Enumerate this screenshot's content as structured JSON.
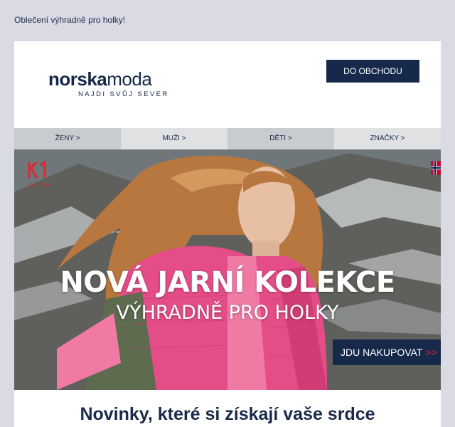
{
  "preheader": "Oblečení výhradně pro holky!",
  "header": {
    "logo_bold": "norska",
    "logo_light": "moda",
    "logo_tagline": "NAJDI SVŮJ SEVER",
    "shop_button": "DO OBCHODU"
  },
  "nav": {
    "items": [
      {
        "label": "ŽENY >"
      },
      {
        "label": "MUŽI >"
      },
      {
        "label": "DĚTI >"
      },
      {
        "label": "ZNAČKY >"
      }
    ]
  },
  "hero": {
    "brand": "KARI TRAA",
    "title": "NOVÁ JARNÍ KOLEKCE",
    "subtitle": "VÝHRADNĚ PRO HOLKY",
    "cta_label": "JDU NAKUPOVAT",
    "cta_arrows": ">>"
  },
  "section": {
    "title": "Novinky, které si získají vaše srdce"
  },
  "colors": {
    "navy": "#16294a",
    "accent_red": "#e0262f",
    "pink": "#e8518a",
    "page_bg": "#d9dae3"
  }
}
